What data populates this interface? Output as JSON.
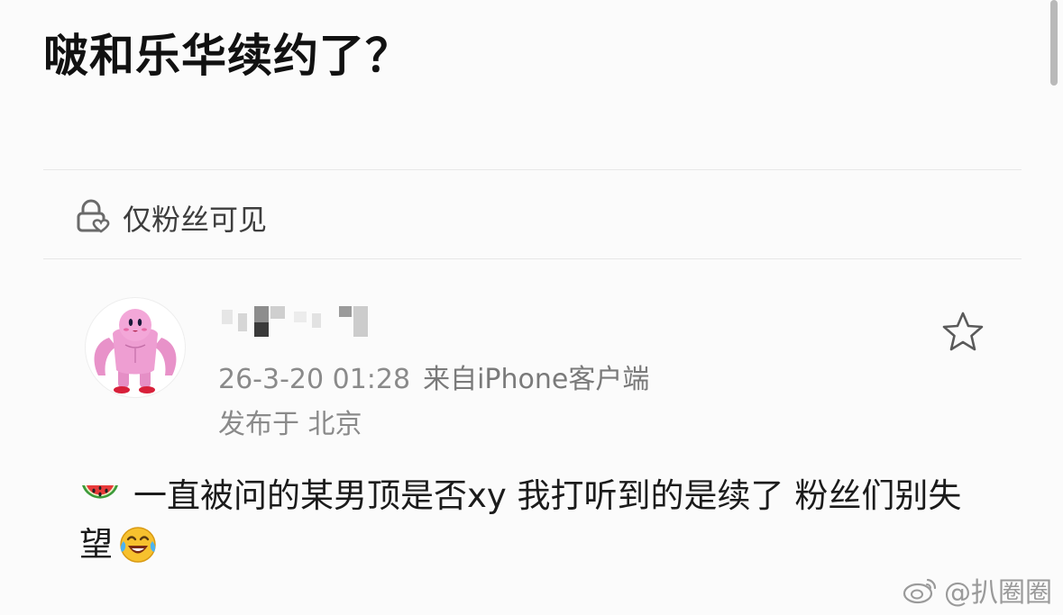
{
  "headline": "啵和乐华续约了？",
  "visibility": {
    "icon": "lock-heart-icon",
    "label": "仅粉丝可见"
  },
  "post": {
    "avatar": "muscular-kirby-avatar",
    "username": "",
    "timestamp": "26-3-20 01:28",
    "source": "来自iPhone客户端",
    "location": "发布于 北京",
    "favorite_icon": "star-icon",
    "leading_emoji": "watermelon-emoji",
    "text": "一直被问的某男顶是否xy 我打听到的是续了 粉丝们别失望",
    "trailing_emoji": "laughing-crying-emoji"
  },
  "watermark": {
    "icon": "weibo-icon",
    "text": "@扒圈圈"
  },
  "colors": {
    "background": "#fbfbfb",
    "meta_text": "#8a8a8a",
    "divider": "#e7e7e7"
  }
}
